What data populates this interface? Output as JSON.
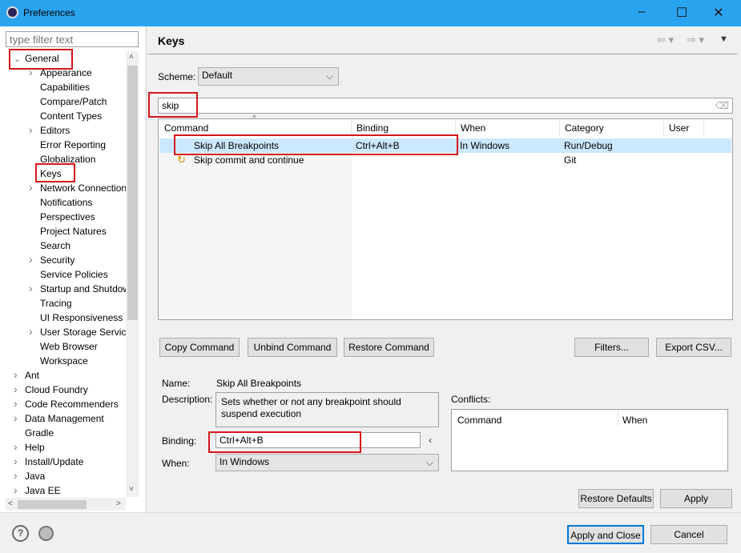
{
  "window": {
    "title": "Preferences",
    "minimize": "–",
    "maximize": "☐",
    "close": "✕"
  },
  "sidebar": {
    "filter_placeholder": "type filter text",
    "general": "General",
    "general_children": [
      "Appearance",
      "Capabilities",
      "Compare/Patch",
      "Content Types",
      "Editors",
      "Error Reporting",
      "Globalization",
      "Keys",
      "Network Connection",
      "Notifications",
      "Perspectives",
      "Project Natures",
      "Search",
      "Security",
      "Service Policies",
      "Startup and Shutdow",
      "Tracing",
      "UI Responsiveness M",
      "User Storage Service",
      "Web Browser",
      "Workspace"
    ],
    "top_level": [
      "Ant",
      "Cloud Foundry",
      "Code Recommenders",
      "Data Management",
      "Gradle",
      "Help",
      "Install/Update",
      "Java",
      "Java EE"
    ]
  },
  "page": {
    "title": "Keys",
    "scheme_label": "Scheme:",
    "scheme_value": "Default",
    "search_value": "skip",
    "columns": [
      "Command",
      "Binding",
      "When",
      "Category",
      "User"
    ],
    "rows": [
      {
        "command": "Skip All Breakpoints",
        "binding": "Ctrl+Alt+B",
        "when": "In Windows",
        "category": "Run/Debug",
        "user": ""
      },
      {
        "command": "Skip commit and continue",
        "binding": "",
        "when": "",
        "category": "Git",
        "user": ""
      }
    ],
    "buttons": {
      "copy": "Copy Command",
      "unbind": "Unbind Command",
      "restore": "Restore Command",
      "filters": "Filters...",
      "export": "Export CSV..."
    },
    "details": {
      "name_label": "Name:",
      "name_value": "Skip All Breakpoints",
      "desc_label": "Description:",
      "desc_value": "Sets whether or not any breakpoint should suspend execution",
      "binding_label": "Binding:",
      "binding_value": "Ctrl+Alt+B",
      "when_label": "When:",
      "when_value": "In Windows",
      "conflicts_label": "Conflicts:",
      "conflicts_cols": [
        "Command",
        "When"
      ]
    },
    "restore_defaults": "Restore Defaults",
    "apply": "Apply"
  },
  "footer": {
    "apply_close": "Apply and Close",
    "cancel": "Cancel"
  }
}
